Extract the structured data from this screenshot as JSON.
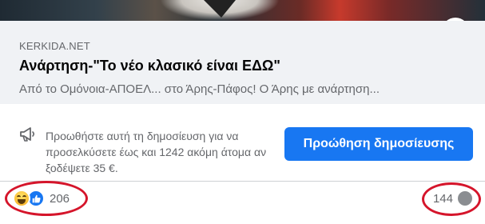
{
  "link_preview": {
    "domain": "KERKIDA.NET",
    "title": "Ανάρτηση-\"Το νέο κλασικό είναι ΕΔΩ\"",
    "description": "Από το Ομόνοια-ΑΠΟΕΛ... στο Άρης-Πάφος! Ο Άρης με ανάρτηση..."
  },
  "promotion": {
    "text": "Προωθήστε αυτή τη δημοσίευση για να προσελκύσετε έως και 1242 ακόμη άτομα αν ξοδέψετε 35 €.",
    "button_label": "Προώθηση δημοσίευσης"
  },
  "reactions": {
    "count": "206",
    "icons": [
      "haha-icon",
      "like-icon"
    ]
  },
  "comments": {
    "count": "144"
  },
  "colors": {
    "accent": "#1877f2",
    "annotation": "#d5152b",
    "secondary_text": "#65676b",
    "link_box_bg": "#f0f2f5"
  }
}
